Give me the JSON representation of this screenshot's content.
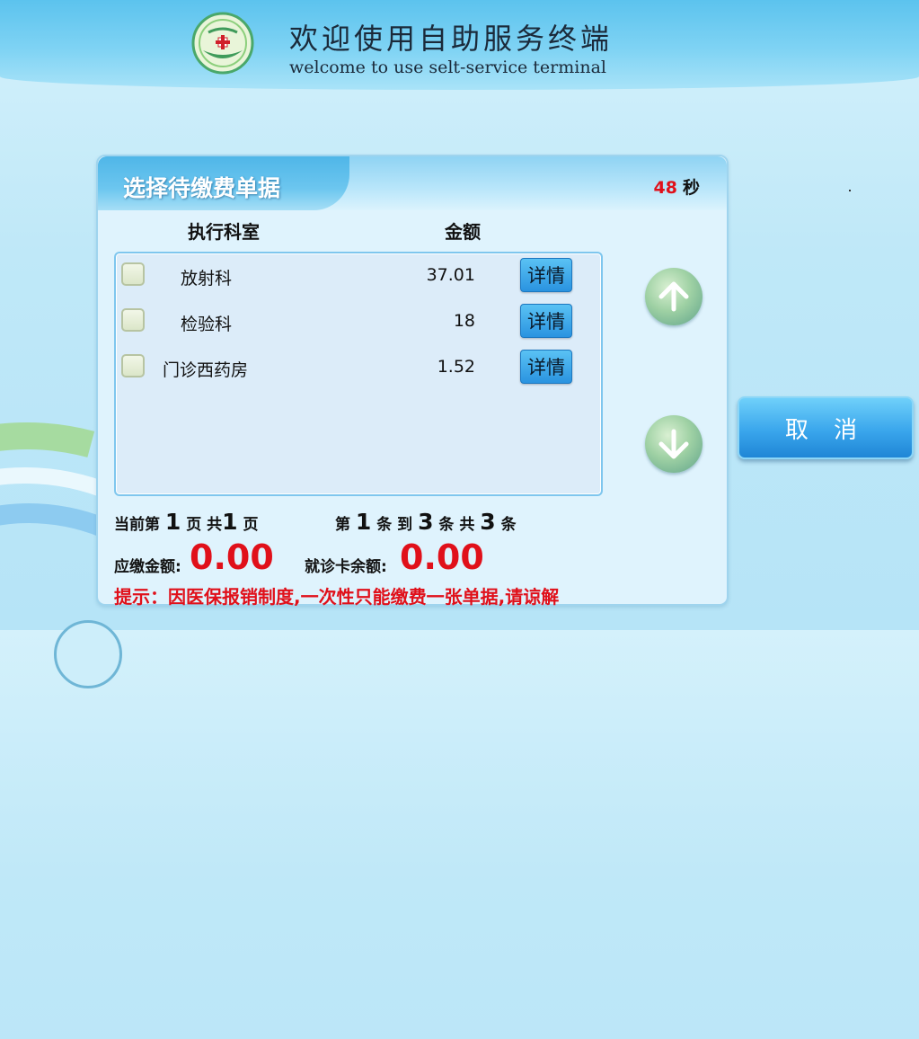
{
  "header": {
    "title_cn": "欢迎使用自助服务终端",
    "title_en": "welcome to use selt-service terminal",
    "logo_icon": "hospital-cross-emblem-icon"
  },
  "panel": {
    "title": "选择待缴费单据",
    "countdown_value": "48",
    "countdown_unit": "秒",
    "columns": {
      "dept": "执行科室",
      "amount": "金额"
    },
    "rows": [
      {
        "dept": "放射科",
        "amount": "37.01",
        "detail": "详情",
        "checked": false
      },
      {
        "dept": "检验科",
        "amount": "18",
        "detail": "详情",
        "checked": false
      },
      {
        "dept": "门诊西药房",
        "amount": "1.52",
        "detail": "详情",
        "checked": false
      }
    ],
    "pagination": {
      "prefix_current": "当前第",
      "current_page": "1",
      "page_word": "页",
      "prefix_total": "共",
      "total_pages": "1",
      "page_word2": "页"
    },
    "records": {
      "prefix": "第",
      "from": "1",
      "mid": "条 到",
      "to": "3",
      "mid2": "条 共",
      "total": "3",
      "suffix": "条"
    },
    "due_label": "应缴金额:",
    "due_value": "0.00",
    "balance_label": "就诊卡余额:",
    "balance_value": "0.00",
    "notice": "提示：因医保报销制度,一次性只能缴费一张单据,请谅解"
  },
  "cancel_button": "取 消",
  "colors": {
    "accent_red": "#e0101a",
    "button_blue": "#2a93e0"
  }
}
